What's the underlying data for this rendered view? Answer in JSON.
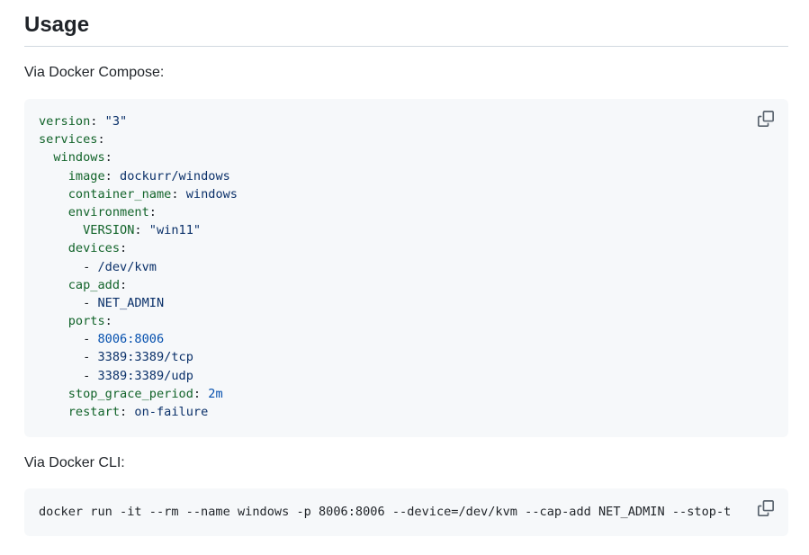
{
  "heading": "Usage",
  "intro_compose": "Via Docker Compose:",
  "compose_lines": [
    [
      {
        "t": "k",
        "v": "version"
      },
      {
        "t": "p",
        "v": ": "
      },
      {
        "t": "s",
        "v": "\"3\""
      }
    ],
    [
      {
        "t": "k",
        "v": "services"
      },
      {
        "t": "p",
        "v": ":"
      }
    ],
    [
      {
        "t": "p",
        "v": "  "
      },
      {
        "t": "k",
        "v": "windows"
      },
      {
        "t": "p",
        "v": ":"
      }
    ],
    [
      {
        "t": "p",
        "v": "    "
      },
      {
        "t": "k",
        "v": "image"
      },
      {
        "t": "p",
        "v": ": "
      },
      {
        "t": "s",
        "v": "dockurr/windows"
      }
    ],
    [
      {
        "t": "p",
        "v": "    "
      },
      {
        "t": "k",
        "v": "container_name"
      },
      {
        "t": "p",
        "v": ": "
      },
      {
        "t": "s",
        "v": "windows"
      }
    ],
    [
      {
        "t": "p",
        "v": "    "
      },
      {
        "t": "k",
        "v": "environment"
      },
      {
        "t": "p",
        "v": ":"
      }
    ],
    [
      {
        "t": "p",
        "v": "      "
      },
      {
        "t": "k",
        "v": "VERSION"
      },
      {
        "t": "p",
        "v": ": "
      },
      {
        "t": "s",
        "v": "\"win11\""
      }
    ],
    [
      {
        "t": "p",
        "v": "    "
      },
      {
        "t": "k",
        "v": "devices"
      },
      {
        "t": "p",
        "v": ":"
      }
    ],
    [
      {
        "t": "p",
        "v": "      - "
      },
      {
        "t": "s",
        "v": "/dev/kvm"
      }
    ],
    [
      {
        "t": "p",
        "v": "    "
      },
      {
        "t": "k",
        "v": "cap_add"
      },
      {
        "t": "p",
        "v": ":"
      }
    ],
    [
      {
        "t": "p",
        "v": "      - "
      },
      {
        "t": "s",
        "v": "NET_ADMIN"
      }
    ],
    [
      {
        "t": "p",
        "v": "    "
      },
      {
        "t": "k",
        "v": "ports"
      },
      {
        "t": "p",
        "v": ":"
      }
    ],
    [
      {
        "t": "p",
        "v": "      - "
      },
      {
        "t": "n",
        "v": "8006:8006"
      }
    ],
    [
      {
        "t": "p",
        "v": "      - "
      },
      {
        "t": "s",
        "v": "3389:3389/tcp"
      }
    ],
    [
      {
        "t": "p",
        "v": "      - "
      },
      {
        "t": "s",
        "v": "3389:3389/udp"
      }
    ],
    [
      {
        "t": "p",
        "v": "    "
      },
      {
        "t": "k",
        "v": "stop_grace_period"
      },
      {
        "t": "p",
        "v": ": "
      },
      {
        "t": "n",
        "v": "2m"
      }
    ],
    [
      {
        "t": "p",
        "v": "    "
      },
      {
        "t": "k",
        "v": "restart"
      },
      {
        "t": "p",
        "v": ": "
      },
      {
        "t": "s",
        "v": "on-failure"
      }
    ]
  ],
  "intro_cli": "Via Docker CLI:",
  "cli_command": "docker run -it --rm --name windows -p 8006:8006 --device=/dev/kvm --cap-add NET_ADMIN --stop-t",
  "icons": {
    "copy": "copy-icon"
  },
  "colors": {
    "code_bg": "#f6f8fa",
    "key": "#116329",
    "string": "#0a3069",
    "number": "#0550ae",
    "text": "#1f2328",
    "icon": "#59636e"
  }
}
